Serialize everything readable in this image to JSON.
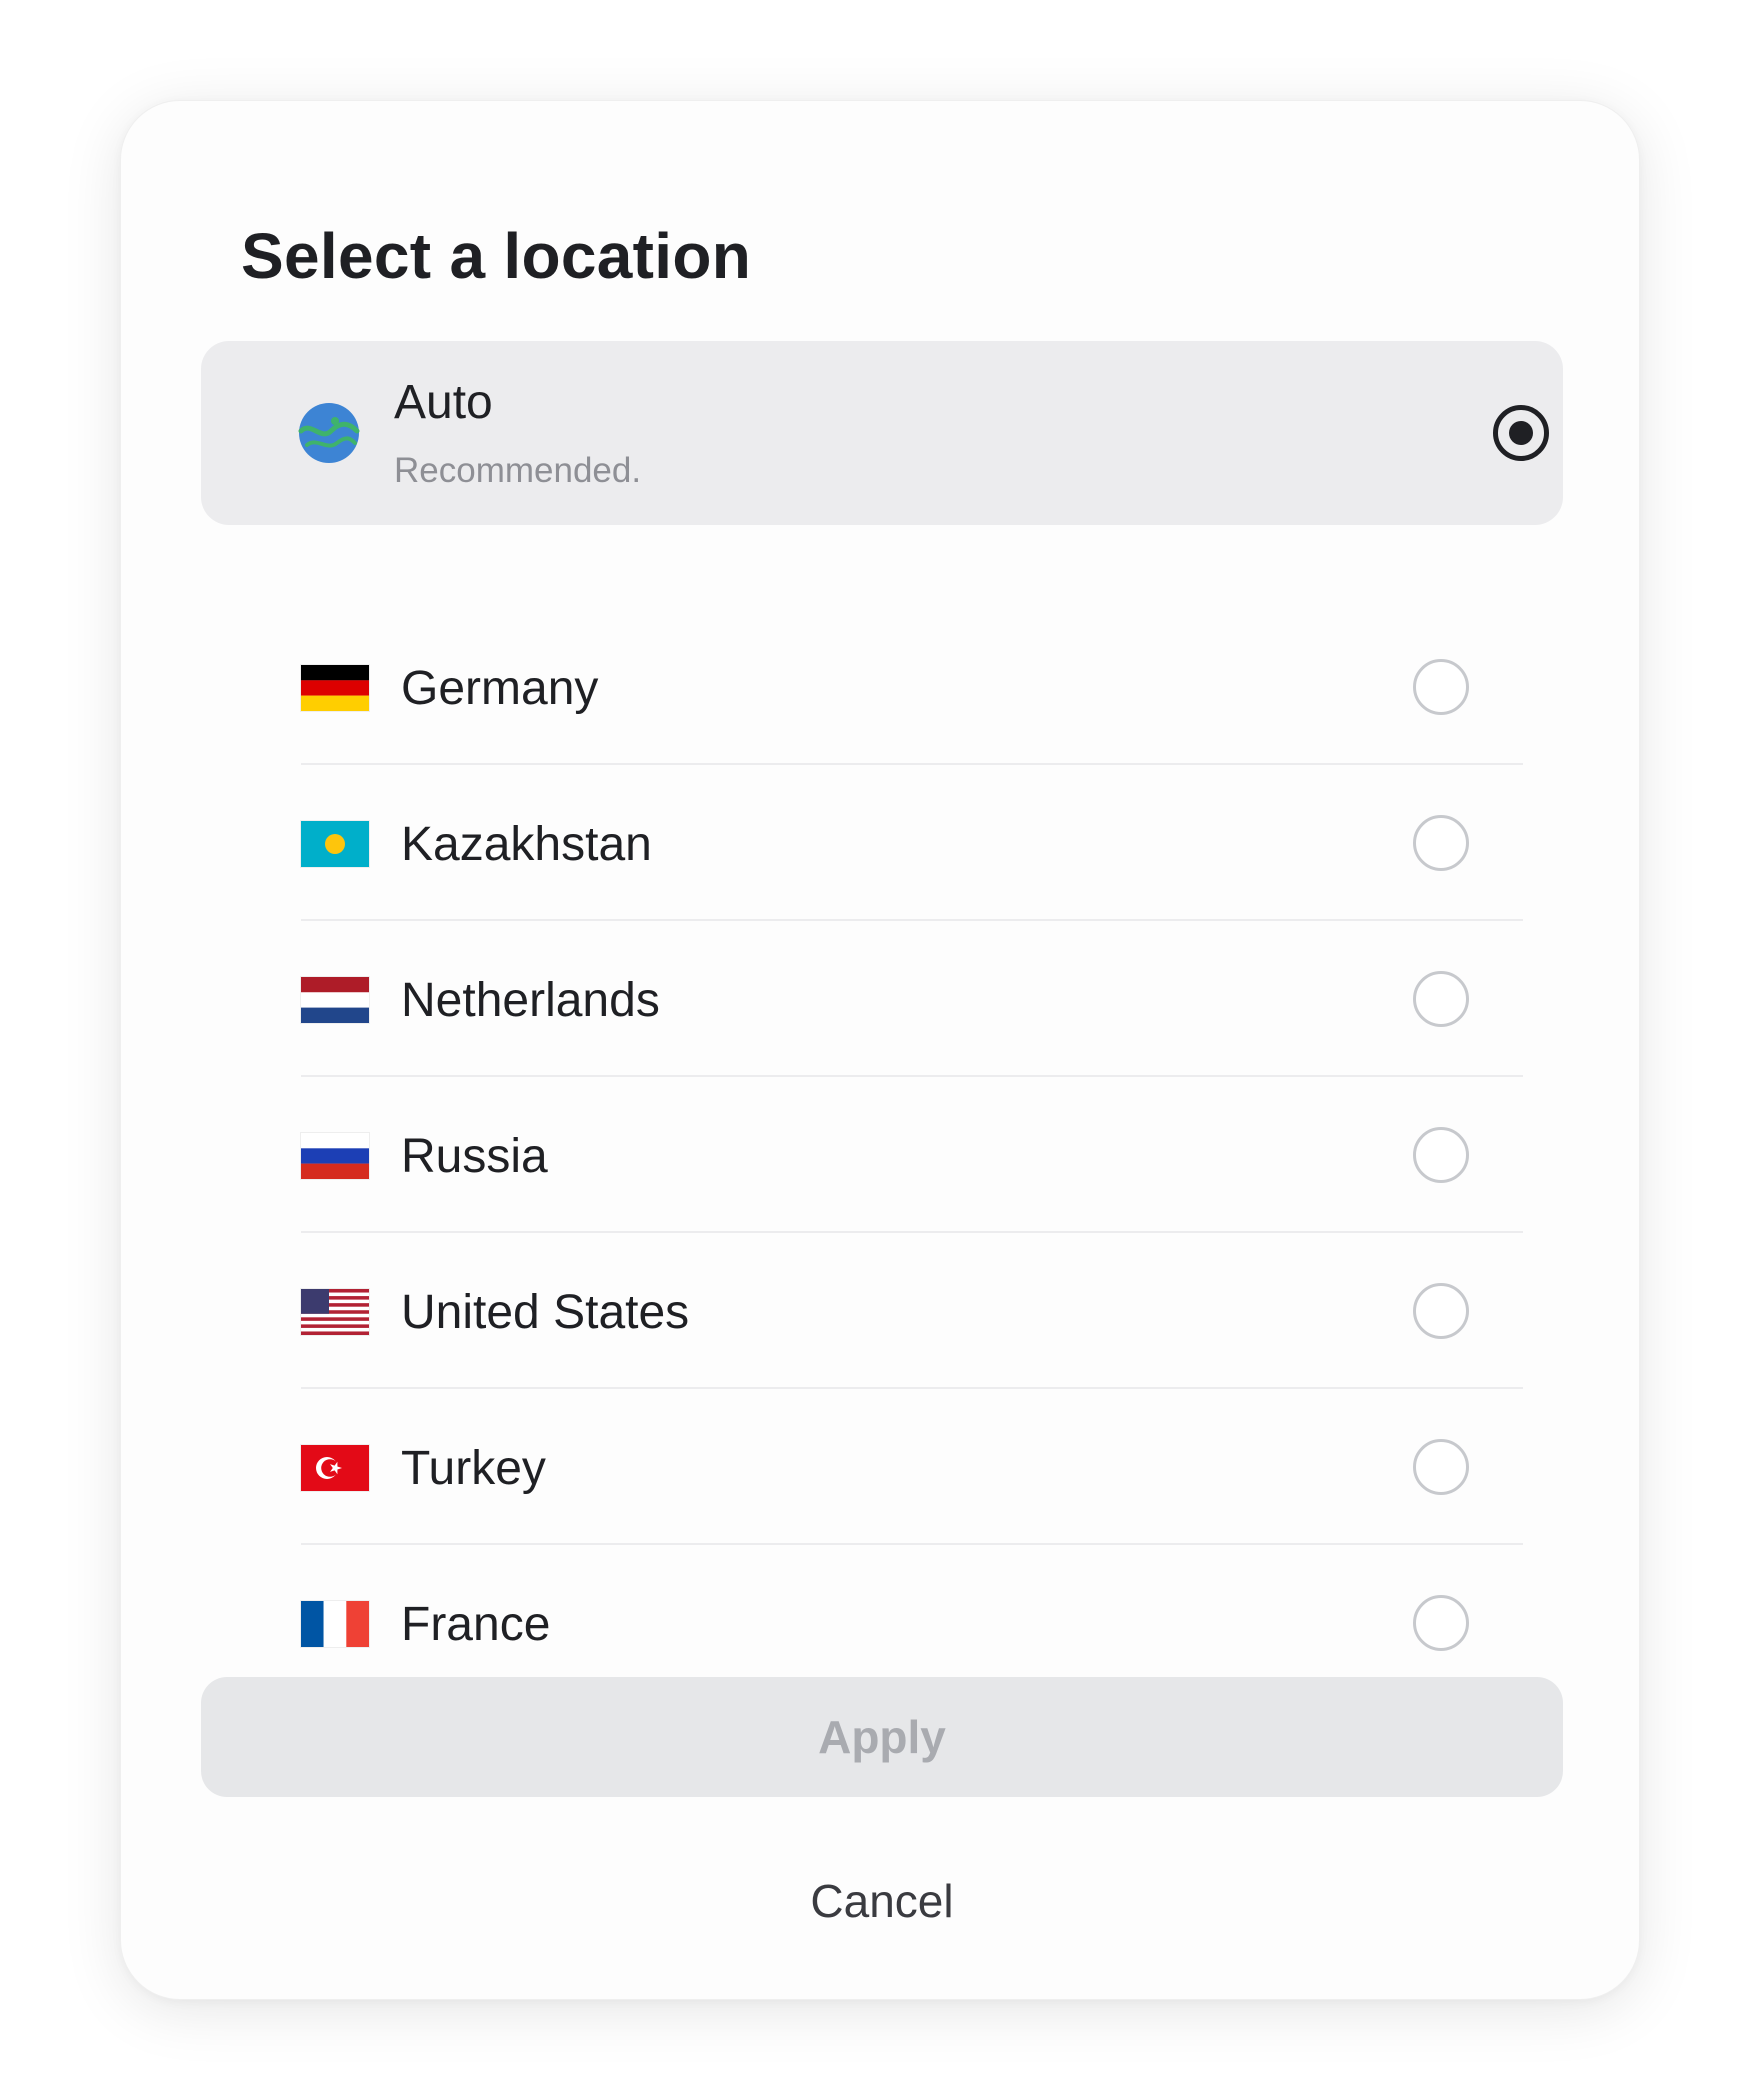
{
  "dialog": {
    "title": "Select a location",
    "selected": "auto"
  },
  "auto_option": {
    "label": "Auto",
    "sublabel": "Recommended.",
    "icon": "globe-icon",
    "selected": true
  },
  "locations": [
    {
      "label": "Germany",
      "icon": "germany-flag-icon",
      "selected": false
    },
    {
      "label": "Kazakhstan",
      "icon": "kazakhstan-flag-icon",
      "selected": false
    },
    {
      "label": "Netherlands",
      "icon": "netherlands-flag-icon",
      "selected": false
    },
    {
      "label": "Russia",
      "icon": "russia-flag-icon",
      "selected": false
    },
    {
      "label": "United States",
      "icon": "united-states-flag-icon",
      "selected": false
    },
    {
      "label": "Turkey",
      "icon": "turkey-flag-icon",
      "selected": false
    },
    {
      "label": "France",
      "icon": "france-flag-icon",
      "selected": false
    }
  ],
  "actions": {
    "apply_label": "Apply",
    "apply_enabled": false,
    "cancel_label": "Cancel"
  },
  "colors": {
    "text_primary": "#1f2024",
    "text_secondary": "#8e8f95",
    "selected_row_bg": "#ececee",
    "disabled_button_bg": "#e6e7e9",
    "disabled_button_text": "#a9abb0",
    "radio_unchecked_border": "#c7c9cd"
  }
}
